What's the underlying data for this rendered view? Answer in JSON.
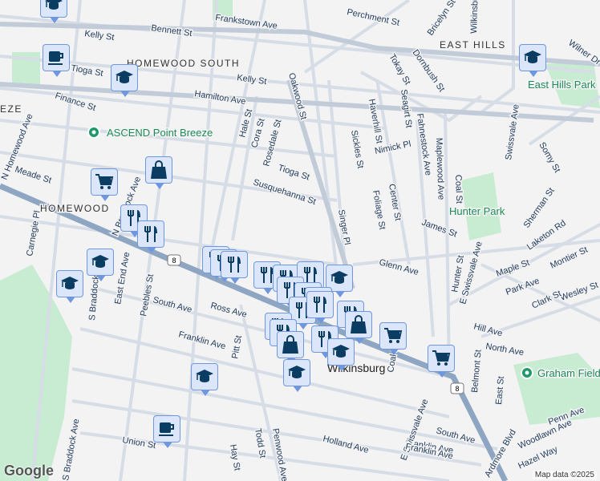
{
  "streets": [
    "Bennett St",
    "Frankstown Ave",
    "Kelly St",
    "Tioga St",
    "Hamilton Ave",
    "Finance St",
    "Kelly St",
    "Oakwood St",
    "Hale St",
    "Cora St",
    "Rosedale St",
    "Tioga St",
    "Susquehanna St",
    "Meade St",
    "N Homewood Ave",
    "N Braddock Ave",
    "Carnegie Pl",
    "S Braddock Ave",
    "East End Ave",
    "Peebles St",
    "South Ave",
    "Ross Ave",
    "Franklin Ave",
    "Pitt St",
    "Union St",
    "Hay St",
    "Todd St",
    "Penwood Ave",
    "Holland Ave",
    "Franklin Ave",
    "South Ave",
    "Penn Ave",
    "Woodlawn Ave",
    "Hazel Way",
    "Ardmore Blvd",
    "E Swissvale Ave",
    "Coal St",
    "North Ave",
    "Hill Ave",
    "Wesley St",
    "Clark St",
    "Park Ave",
    "Maple St",
    "Montier St",
    "Laketon Rd",
    "Sherman St",
    "James St",
    "Glenn Ave",
    "Singer Pl",
    "Foliage St",
    "Center St",
    "Sickles St",
    "Haverhill St",
    "Nimick Pl",
    "Seagirt St",
    "Fahnestock Ave",
    "Maplewood Ave",
    "Coal St",
    "Swissvale Ave",
    "Somy St",
    "Tokay St",
    "Dornbush St",
    "Bricelyn St",
    "Wilkinsburg",
    "Wilner Dr",
    "Perchment St",
    "Hunter St",
    "Belmont St",
    "East St",
    "E Swissvale Ave",
    "S Braddock Ave",
    "Franklin Ave"
  ],
  "neighborhoods": [
    "HOMEWOOD SOUTH",
    "HOMEWOOD",
    "EAST HILLS",
    "EZE"
  ],
  "parks": [
    "ASCEND Point Breeze",
    "East Hills Park",
    "Hunter Park",
    "Graham Field"
  ],
  "city_label": "Wilkinsburg",
  "route_shield": "8",
  "attribution": "Map data ©2025",
  "logo": "Google",
  "colors": {
    "marker_fill": "#dbe6fa",
    "marker_border": "#6f97de",
    "icon": "#0b3d63",
    "park": "#c8ecd2",
    "highway": "#8fa6c2"
  }
}
